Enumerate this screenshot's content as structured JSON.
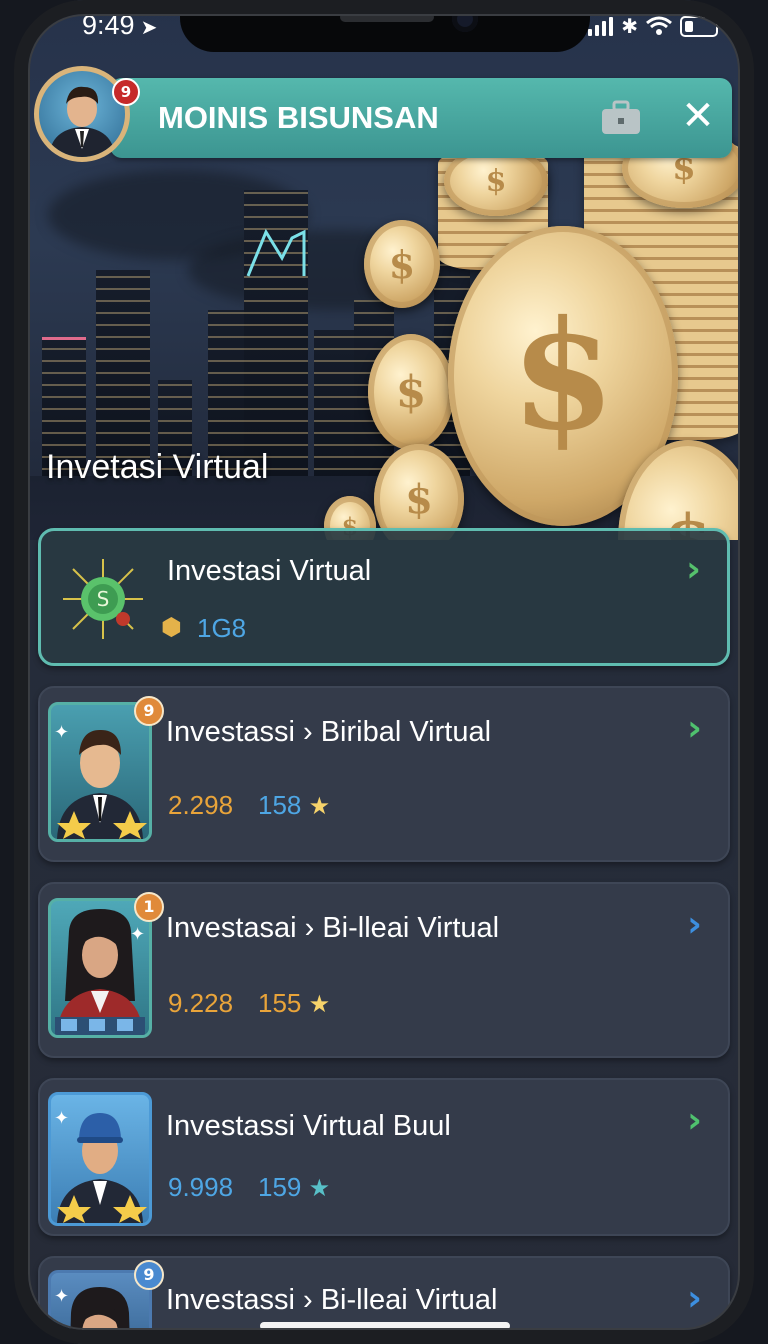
{
  "status": {
    "time": "9:49"
  },
  "header": {
    "title": "MOINIS BISUNSAN",
    "avatar_badge": "9"
  },
  "hero": {
    "title": "Invetasi Virtual"
  },
  "featured": {
    "name": "Investasi Virtual",
    "value": "1G8"
  },
  "items": [
    {
      "name": "Investassi › Biribal Virtual",
      "value1": "2.298",
      "value2": "158",
      "badge": "9",
      "chevron_color": "#4fc16e"
    },
    {
      "name": "Investasai › Bi-lleai Virtual",
      "value1": "9.228",
      "value2": "155",
      "badge": "1",
      "chevron_color": "#3d8fe0"
    },
    {
      "name": "Investassi Virtual Buul",
      "value1": "9.998",
      "value2": "159",
      "badge": "",
      "chevron_color": "#4fc16e"
    },
    {
      "name": "Investassi › Bi-lleai Virtual",
      "value1": "",
      "value2": "",
      "badge": "9",
      "chevron_color": "#3d8fe0"
    }
  ],
  "icons": [
    "location-arrow-icon",
    "signal-icon",
    "bluetooth-icon",
    "wifi-icon",
    "battery-icon",
    "briefcase-icon",
    "close-icon",
    "coin-icon",
    "chevron-right-icon",
    "star-icon"
  ]
}
